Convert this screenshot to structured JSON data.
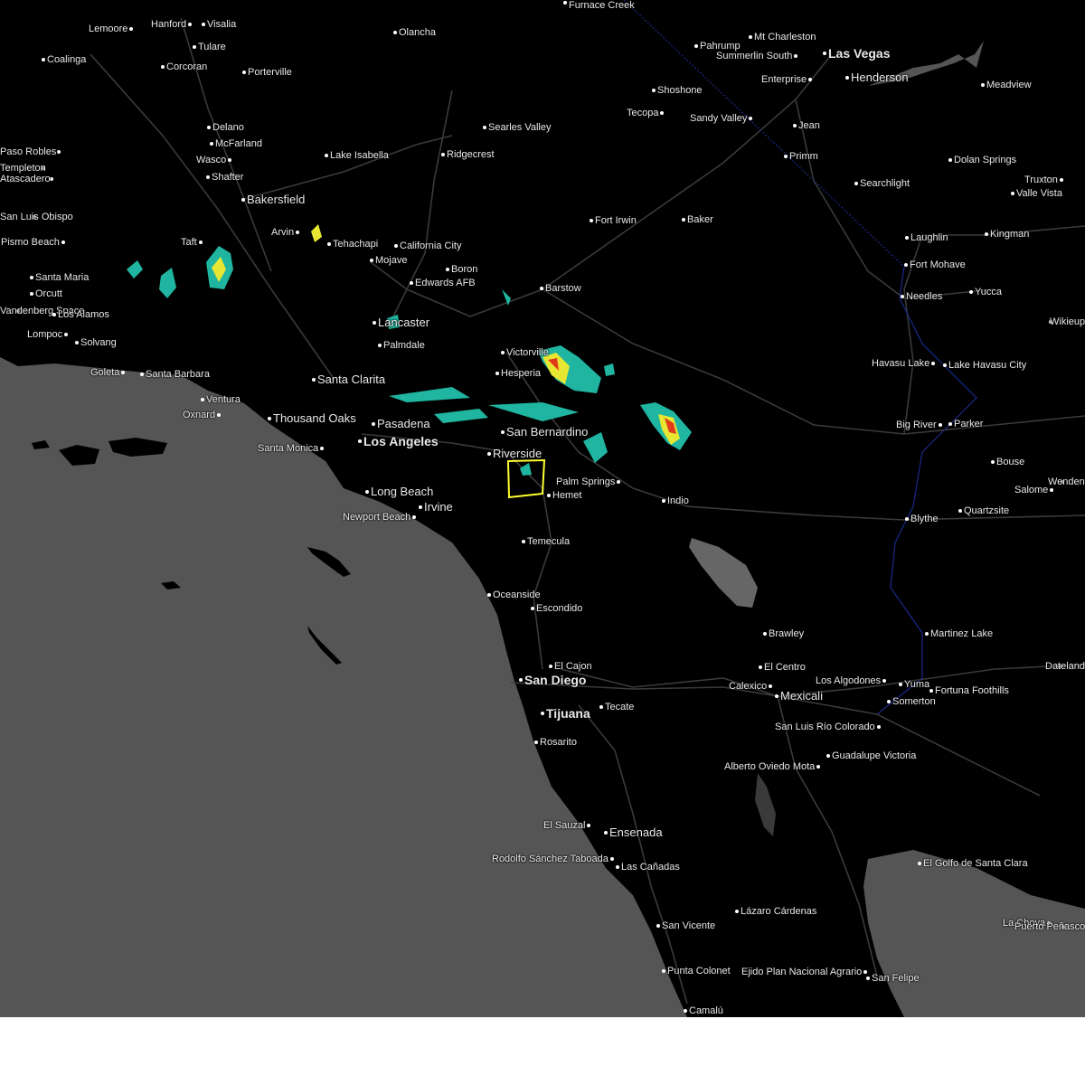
{
  "map": {
    "colors": {
      "ocean": "#555555",
      "land": "#000000",
      "roads": "#3a3a3a",
      "border": "#1a2a8a",
      "warning_box": "#ffff33",
      "radar_light": "#1fb5a0",
      "radar_mid": "#e6e633",
      "radar_high": "#e03a1a"
    },
    "cities": [
      {
        "name": "Lemoore"
      },
      {
        "name": "Hanford"
      },
      {
        "name": "Visalia"
      },
      {
        "name": "Olancha"
      },
      {
        "name": "Coalinga"
      },
      {
        "name": "Tulare"
      },
      {
        "name": "Corcoran"
      },
      {
        "name": "Porterville"
      },
      {
        "name": "Pahrump"
      },
      {
        "name": "Mt Charleston"
      },
      {
        "name": "Summerlin South"
      },
      {
        "name": "Las Vegas"
      },
      {
        "name": "Henderson"
      },
      {
        "name": "Enterprise"
      },
      {
        "name": "Shoshone"
      },
      {
        "name": "Meadview"
      },
      {
        "name": "Tecopa"
      },
      {
        "name": "Sandy Valley"
      },
      {
        "name": "Jean"
      },
      {
        "name": "Delano"
      },
      {
        "name": "McFarland"
      },
      {
        "name": "Searles Valley"
      },
      {
        "name": "Paso Robles"
      },
      {
        "name": "Lake Isabella"
      },
      {
        "name": "Ridgecrest"
      },
      {
        "name": "Wasco"
      },
      {
        "name": "Primm"
      },
      {
        "name": "Dolan Springs"
      },
      {
        "name": "Templeton"
      },
      {
        "name": "Atascadero"
      },
      {
        "name": "Shafter"
      },
      {
        "name": "Truxton"
      },
      {
        "name": "Valle Vista"
      },
      {
        "name": "Searchlight"
      },
      {
        "name": "Bakersfield"
      },
      {
        "name": "San Luis Obispo"
      },
      {
        "name": "Fort Irwin"
      },
      {
        "name": "Baker"
      },
      {
        "name": "Arvin"
      },
      {
        "name": "Laughlin"
      },
      {
        "name": "Kingman"
      },
      {
        "name": "Tehachapi"
      },
      {
        "name": "California City"
      },
      {
        "name": "Taft"
      },
      {
        "name": "Pismo Beach"
      },
      {
        "name": "Mojave"
      },
      {
        "name": "Fort Mohave"
      },
      {
        "name": "Boron"
      },
      {
        "name": "Santa Maria"
      },
      {
        "name": "Edwards AFB"
      },
      {
        "name": "Barstow"
      },
      {
        "name": "Yucca"
      },
      {
        "name": "Orcutt"
      },
      {
        "name": "Needles"
      },
      {
        "name": "Vandenberg Space"
      },
      {
        "name": "Los Alamos"
      },
      {
        "name": "Lancaster"
      },
      {
        "name": "Wikieup"
      },
      {
        "name": "Lompoc"
      },
      {
        "name": "Solvang"
      },
      {
        "name": "Palmdale"
      },
      {
        "name": "Victorville"
      },
      {
        "name": "Hesperia"
      },
      {
        "name": "Lake Havasu City"
      },
      {
        "name": "Havasu Lake"
      },
      {
        "name": "Goleta"
      },
      {
        "name": "Santa Barbara"
      },
      {
        "name": "Santa Clarita"
      },
      {
        "name": "Ventura"
      },
      {
        "name": "Oxnard"
      },
      {
        "name": "Thousand Oaks"
      },
      {
        "name": "Pasadena"
      },
      {
        "name": "San Bernardino"
      },
      {
        "name": "Big River"
      },
      {
        "name": "Parker"
      },
      {
        "name": "Los Angeles"
      },
      {
        "name": "Santa Monica"
      },
      {
        "name": "Riverside"
      },
      {
        "name": "Bouse"
      },
      {
        "name": "Palm Springs"
      },
      {
        "name": "Salome"
      },
      {
        "name": "Wenden"
      },
      {
        "name": "Long Beach"
      },
      {
        "name": "Hemet"
      },
      {
        "name": "Indio"
      },
      {
        "name": "Irvine"
      },
      {
        "name": "Newport Beach"
      },
      {
        "name": "Blythe"
      },
      {
        "name": "Quartzsite"
      },
      {
        "name": "Temecula"
      },
      {
        "name": "Oceanside"
      },
      {
        "name": "Escondido"
      },
      {
        "name": "Brawley"
      },
      {
        "name": "Martinez Lake"
      },
      {
        "name": "El Cajon"
      },
      {
        "name": "El Centro"
      },
      {
        "name": "Dateland"
      },
      {
        "name": "San Diego"
      },
      {
        "name": "Los Algodones"
      },
      {
        "name": "Yuma"
      },
      {
        "name": "Fortuna Foothills"
      },
      {
        "name": "Calexico"
      },
      {
        "name": "Mexicali"
      },
      {
        "name": "Somerton"
      },
      {
        "name": "Tecate"
      },
      {
        "name": "Tijuana"
      },
      {
        "name": "San Luis Río Colorado"
      },
      {
        "name": "Rosarito"
      },
      {
        "name": "Guadalupe Victoria"
      },
      {
        "name": "Alberto Oviedo Mota"
      },
      {
        "name": "El Sauzal"
      },
      {
        "name": "Ensenada"
      },
      {
        "name": "El Golfo de Santa Clara"
      },
      {
        "name": "Rodolfo Sánchez Taboada"
      },
      {
        "name": "Las Cañadas"
      },
      {
        "name": "Lázaro Cárdenas"
      },
      {
        "name": "La Choya"
      },
      {
        "name": "Puerto Peñasco"
      },
      {
        "name": "San Vicente"
      },
      {
        "name": "Ejido Plan Nacional Agrario"
      },
      {
        "name": "San Felipe"
      },
      {
        "name": "Punta Colonet"
      },
      {
        "name": "Camalú"
      },
      {
        "name": "Furnace Creek"
      }
    ]
  }
}
